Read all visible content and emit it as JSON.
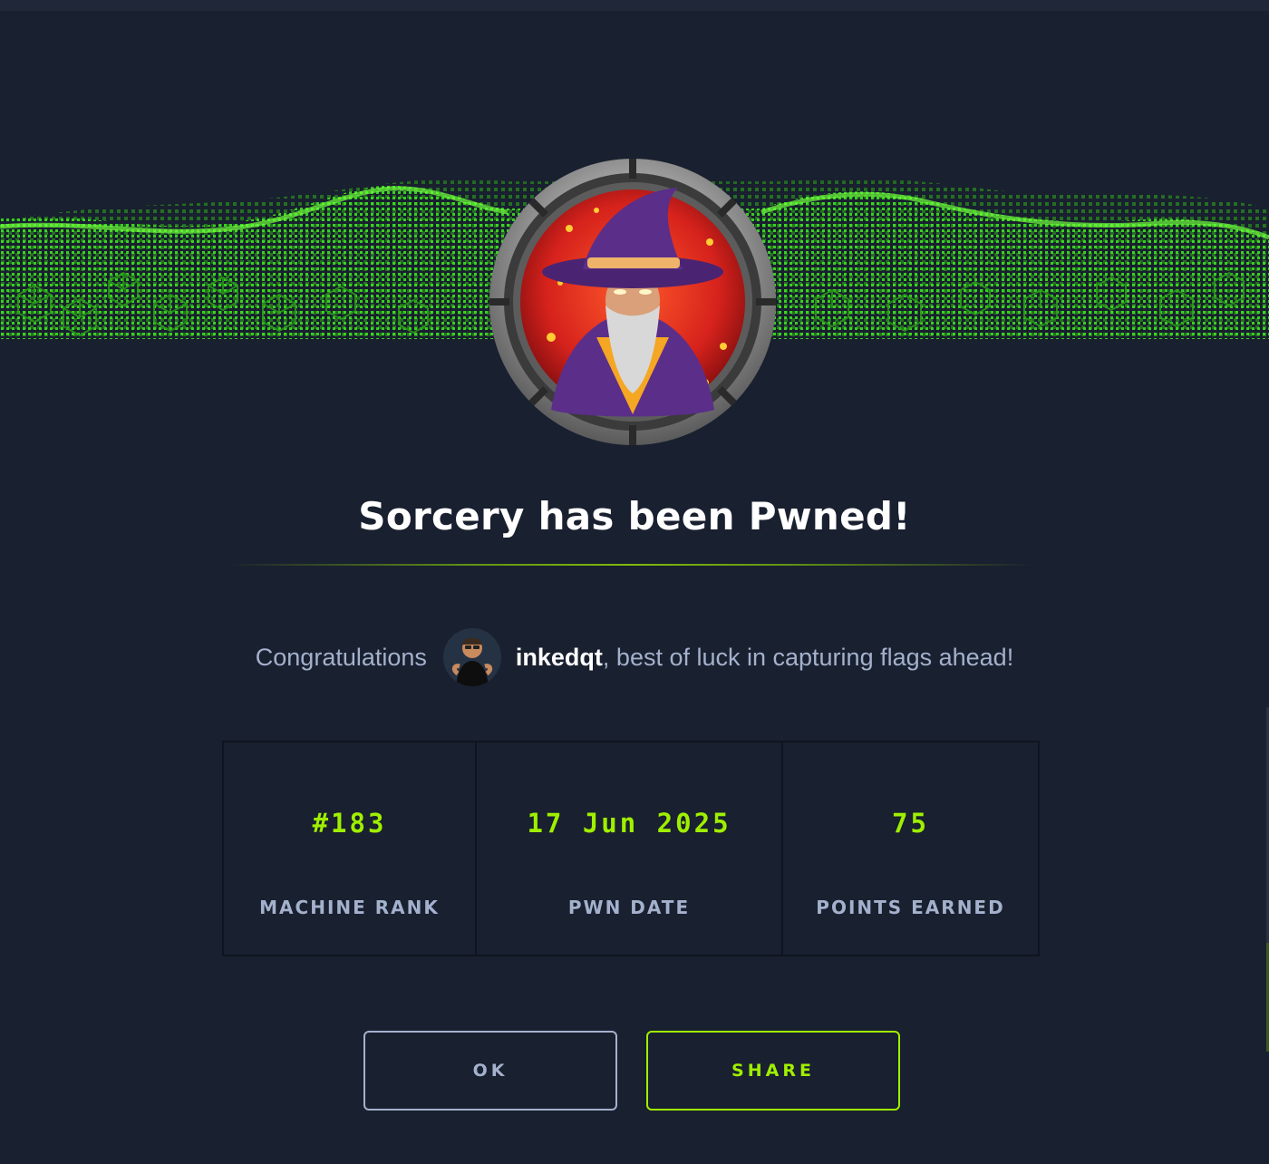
{
  "modal": {
    "title": "Sorcery has been Pwned!",
    "congrats": {
      "prefix": "Congratulations",
      "username": "inkedqt",
      "suffix": ", best of luck in capturing flags ahead!"
    },
    "stats": [
      {
        "value": "#183",
        "label": "MACHINE RANK"
      },
      {
        "value": "17 Jun 2025",
        "label": "PWN DATE"
      },
      {
        "value": "75",
        "label": "POINTS EARNED"
      }
    ],
    "buttons": {
      "ok": "OK",
      "share": "SHARE"
    }
  },
  "icons": {
    "badge": "wizard-machine-badge",
    "avatar": "user-avatar",
    "banner": "green-cube-wave-banner"
  },
  "colors": {
    "background": "#19202f",
    "accent": "#9fef00",
    "text_muted": "#a4b1cd",
    "text_primary": "#ffffff"
  }
}
